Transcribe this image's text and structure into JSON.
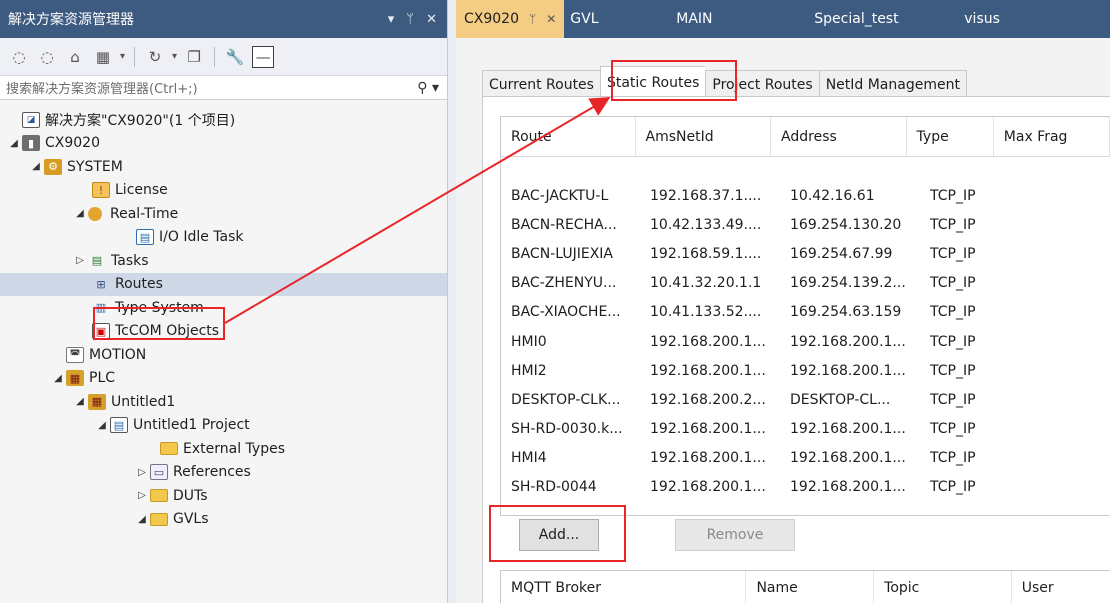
{
  "left": {
    "title": "解决方案资源管理器",
    "title_controls": [
      "▾",
      "ᛘ",
      "✕"
    ],
    "search_placeholder": "搜索解决方案资源管理器(Ctrl+;)",
    "tree": [
      {
        "label": "解决方案\"CX9020\"(1 个项目)",
        "icon": "solution-icon"
      },
      {
        "label": "CX9020",
        "icon": "cx-device-icon"
      },
      {
        "label": "SYSTEM",
        "icon": "system-icon"
      },
      {
        "label": "License",
        "icon": "license-icon"
      },
      {
        "label": "Real-Time",
        "icon": "realtime-icon"
      },
      {
        "label": "I/O Idle Task",
        "icon": "task-icon"
      },
      {
        "label": "Tasks",
        "icon": "tasks-icon"
      },
      {
        "label": "Routes",
        "icon": "routes-icon"
      },
      {
        "label": "Type System",
        "icon": "type-system-icon"
      },
      {
        "label": "TcCOM Objects",
        "icon": "tccom-icon"
      },
      {
        "label": "MOTION",
        "icon": "motion-icon"
      },
      {
        "label": "PLC",
        "icon": "plc-icon"
      },
      {
        "label": "Untitled1",
        "icon": "plc-project-icon"
      },
      {
        "label": "Untitled1 Project",
        "icon": "project-icon"
      },
      {
        "label": "External Types",
        "icon": "folder-icon"
      },
      {
        "label": "References",
        "icon": "references-icon"
      },
      {
        "label": "DUTs",
        "icon": "folder-icon"
      },
      {
        "label": "GVLs",
        "icon": "folder-open-icon"
      }
    ]
  },
  "doc_tabs": [
    "CX9020",
    "GVL",
    "MAIN",
    "Special_test",
    "visus"
  ],
  "doc_tab_active_controls": [
    "ᛘ",
    "✕"
  ],
  "config_tabs": [
    "Current Routes",
    "Static Routes",
    "Project Routes",
    "NetId Management"
  ],
  "routes_table": {
    "headers": [
      "Route",
      "AmsNetId",
      "Address",
      "Type",
      "Max Frag"
    ],
    "rows": [
      [
        "BAC-JACKTU-L",
        "192.168.37.1....",
        "10.42.16.61",
        "TCP_IP"
      ],
      [
        "BACN-RECHA...",
        "10.42.133.49....",
        "169.254.130.20",
        "TCP_IP"
      ],
      [
        "BACN-LUJIEXIA",
        "192.168.59.1....",
        "169.254.67.99",
        "TCP_IP"
      ],
      [
        "BAC-ZHENYU...",
        "10.41.32.20.1.1",
        "169.254.139.2...",
        "TCP_IP"
      ],
      [
        "BAC-XIAOCHE...",
        "10.41.133.52....",
        "169.254.63.159",
        "TCP_IP"
      ],
      [
        "HMI0",
        "192.168.200.1...",
        "192.168.200.1...",
        "TCP_IP"
      ],
      [
        "HMI2",
        "192.168.200.1...",
        "192.168.200.1...",
        "TCP_IP"
      ],
      [
        "DESKTOP-CLK...",
        "192.168.200.2...",
        "DESKTOP-CL...",
        "TCP_IP"
      ],
      [
        "SH-RD-0030.k...",
        "192.168.200.1...",
        "192.168.200.1...",
        "TCP_IP"
      ],
      [
        "HMI4",
        "192.168.200.1...",
        "192.168.200.1...",
        "TCP_IP"
      ],
      [
        "SH-RD-0044",
        "192.168.200.1...",
        "192.168.200.1...",
        "TCP_IP"
      ]
    ]
  },
  "buttons": {
    "add": "Add...",
    "remove": "Remove"
  },
  "mqtt_table": {
    "headers": [
      "MQTT Broker",
      "Name",
      "Topic",
      "User"
    ]
  },
  "colors": {
    "title_bar": "#3d5a80",
    "active_tab": "#f5cc84",
    "highlight": "#e8262a",
    "selection": "#cfd8e7"
  }
}
